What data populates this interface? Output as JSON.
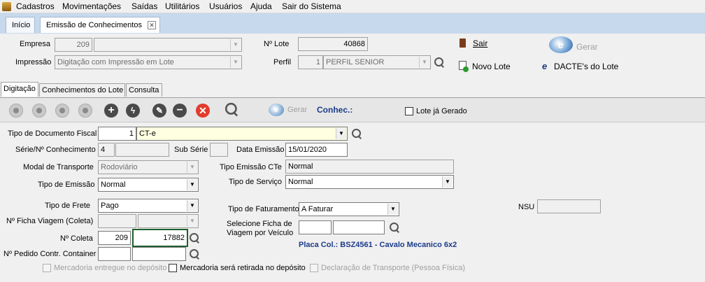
{
  "menu": {
    "items": [
      "Cadastros",
      "Movimentações",
      "Saídas",
      "Utilitários",
      "Usuários",
      "Ajuda",
      "Sair do Sistema"
    ]
  },
  "tabs": {
    "home": "Início",
    "active": "Emissão de Conhecimentos"
  },
  "header": {
    "empresa_label": "Empresa",
    "empresa_code": "209",
    "impressao_label": "Impressão",
    "impressao_value": "Digitação com Impressão em Lote",
    "lote_label": "Nº Lote",
    "lote_value": "40868",
    "perfil_label": "Perfil",
    "perfil_code": "1",
    "perfil_value": "PERFIL SENIOR",
    "sair": "Sair",
    "gerar": "Gerar",
    "novo_lote": "Novo Lote",
    "dacte": "DACTE's do Lote"
  },
  "subtabs": [
    "Digitação",
    "Conhecimentos do Lote",
    "Consulta"
  ],
  "toolbar": {
    "gerar": "Gerar",
    "conhec": "Conhec.:",
    "lote_gerado": "Lote já Gerado"
  },
  "form": {
    "tipo_doc_label": "Tipo de Documento Fiscal",
    "tipo_doc_code": "1",
    "tipo_doc_value": "CT-e",
    "serie_label": "Série/Nº Conhecimento",
    "serie_value": "4",
    "sub_serie_label": "Sub Série",
    "data_emissao_label": "Data Emissão",
    "data_emissao_value": "15/01/2020",
    "modal_label": "Modal de Transporte",
    "modal_value": "Rodoviário",
    "tipo_emissao_cte_label": "Tipo Emissão CTe",
    "tipo_emissao_cte_value": "Normal",
    "tipo_emissao_label": "Tipo de Emissão",
    "tipo_emissao_value": "Normal",
    "tipo_servico_label": "Tipo de Serviço",
    "tipo_servico_value": "Normal",
    "tipo_frete_label": "Tipo de Frete",
    "tipo_frete_value": "Pago",
    "tipo_faturamento_label": "Tipo de Faturamento",
    "tipo_faturamento_value": "A Faturar",
    "nsu_label": "NSU",
    "ficha_label": "Nº Ficha Viagem (Coleta)",
    "sel_ficha_label_1": "Selecione Ficha de",
    "sel_ficha_label_2": "Viagem por Veículo",
    "coleta_label": "Nº Coleta",
    "coleta_code": "209",
    "coleta_value": "17882",
    "placa": "Placa Col.: BSZ4561 - Cavalo Mecanico 6x2",
    "pedido_label": "Nº Pedido Contr. Container",
    "chk_deposito": "Mercadoria entregue no depósito",
    "chk_retirada": "Mercadoria será retirada no depósito",
    "chk_declaracao": "Declaração de Transporte (Pessoa Física)"
  },
  "colors": {
    "tab_strip": "#c7d9ec",
    "highlight_yellow": "#ffffe1",
    "focus_border": "#1f5f2d",
    "accent_blue": "#1b3b8a"
  }
}
